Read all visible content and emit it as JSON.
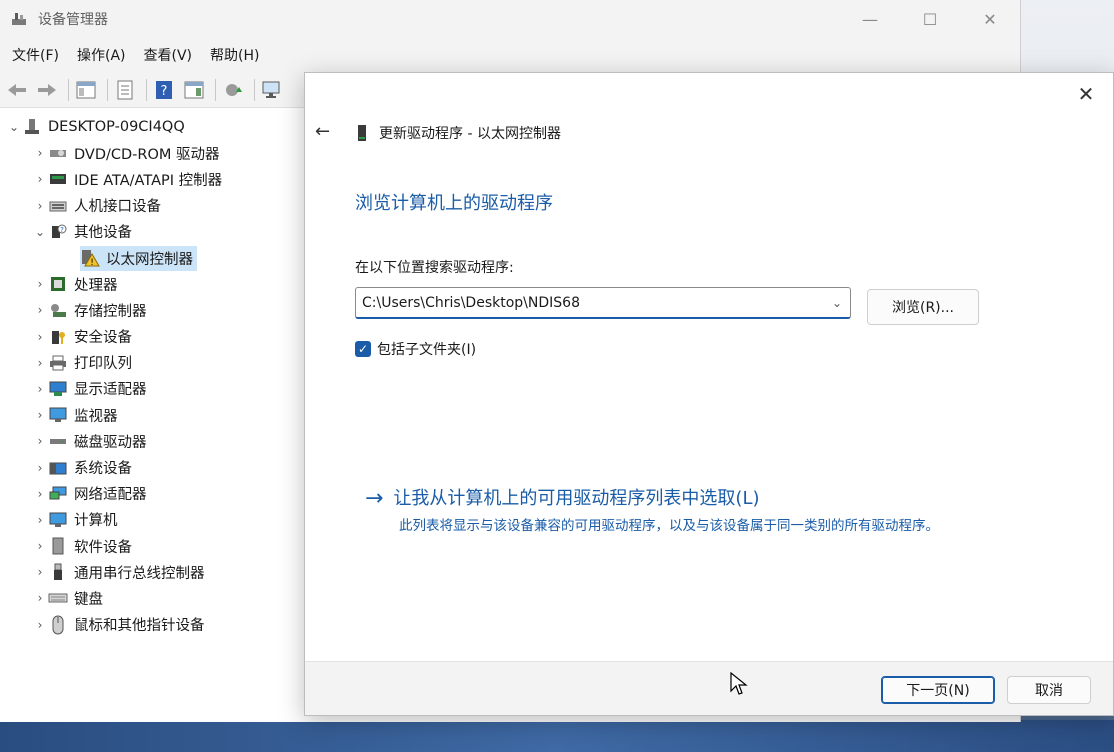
{
  "window": {
    "title": "设备管理器",
    "controls": {
      "minimize": "—",
      "maximize": "☐",
      "close": "✕"
    }
  },
  "menu": [
    {
      "label": "文件(F)"
    },
    {
      "label": "操作(A)"
    },
    {
      "label": "查看(V)"
    },
    {
      "label": "帮助(H)"
    }
  ],
  "tree": {
    "root": "DESKTOP-09CI4QQ",
    "items": [
      {
        "label": "DVD/CD-ROM 驱动器",
        "icon": "dvd-drive-icon"
      },
      {
        "label": "IDE ATA/ATAPI 控制器",
        "icon": "ide-controller-icon"
      },
      {
        "label": "人机接口设备",
        "icon": "hid-icon"
      },
      {
        "label": "其他设备",
        "icon": "other-devices-icon",
        "expanded": true,
        "children": [
          {
            "label": "以太网控制器",
            "icon": "warning-device-icon",
            "selected": true
          }
        ]
      },
      {
        "label": "处理器",
        "icon": "processor-icon"
      },
      {
        "label": "存储控制器",
        "icon": "storage-controller-icon"
      },
      {
        "label": "安全设备",
        "icon": "security-device-icon"
      },
      {
        "label": "打印队列",
        "icon": "printer-icon"
      },
      {
        "label": "显示适配器",
        "icon": "display-adapter-icon"
      },
      {
        "label": "监视器",
        "icon": "monitor-icon"
      },
      {
        "label": "磁盘驱动器",
        "icon": "disk-drive-icon"
      },
      {
        "label": "系统设备",
        "icon": "system-device-icon"
      },
      {
        "label": "网络适配器",
        "icon": "network-adapter-icon"
      },
      {
        "label": "计算机",
        "icon": "computer-icon"
      },
      {
        "label": "软件设备",
        "icon": "software-device-icon"
      },
      {
        "label": "通用串行总线控制器",
        "icon": "usb-icon"
      },
      {
        "label": "键盘",
        "icon": "keyboard-icon"
      },
      {
        "label": "鼠标和其他指针设备",
        "icon": "mouse-icon"
      }
    ]
  },
  "dialog": {
    "header": "更新驱动程序 - 以太网控制器",
    "heading": "浏览计算机上的驱动程序",
    "prompt": "在以下位置搜索驱动程序:",
    "path_value": "C:\\Users\\Chris\\Desktop\\NDIS68",
    "browse_label": "浏览(R)...",
    "include_subfolders_label": "包括子文件夹(I)",
    "include_subfolders_checked": true,
    "pick_title": "让我从计算机上的可用驱动程序列表中选取(L)",
    "pick_desc": "此列表将显示与该设备兼容的可用驱动程序，以及与该设备属于同一类别的所有驱动程序。",
    "next_label": "下一页(N)",
    "cancel_label": "取消"
  },
  "colors": {
    "accent": "#1a5ca8",
    "selection": "#cce4f7"
  }
}
